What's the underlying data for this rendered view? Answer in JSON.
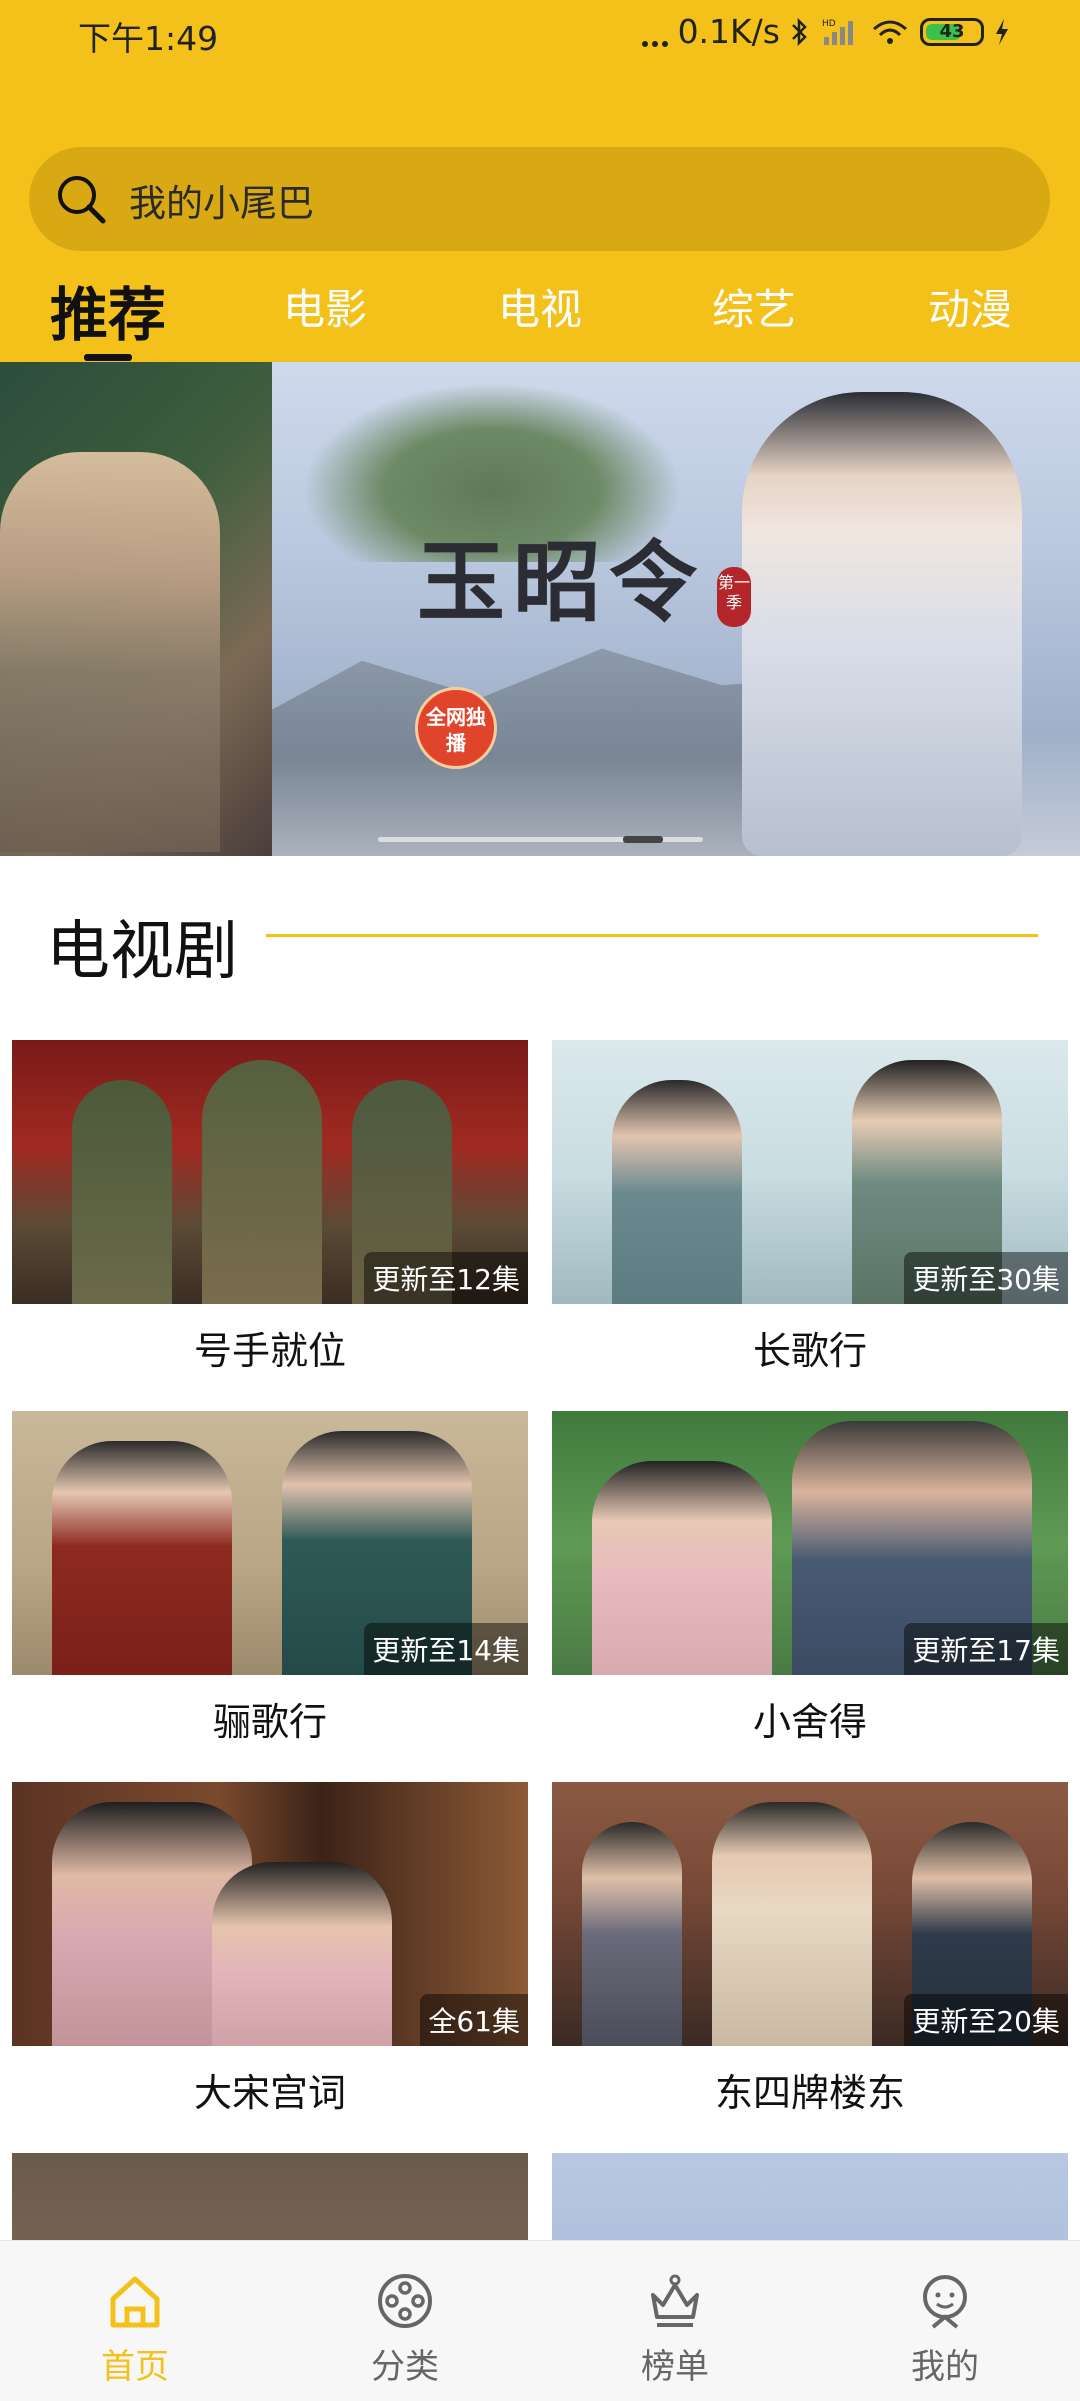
{
  "status_bar": {
    "time": "下午1:49",
    "network_speed": "0.1K/s",
    "battery": "43"
  },
  "search": {
    "placeholder_text": "我的小尾巴"
  },
  "tabs": [
    {
      "label": "推荐",
      "active": true
    },
    {
      "label": "电影"
    },
    {
      "label": "电视"
    },
    {
      "label": "综艺"
    },
    {
      "label": "动漫"
    }
  ],
  "banner": {
    "title": "玉昭令",
    "season_tag": "第一季",
    "badge": "全网独播"
  },
  "section": {
    "title": "电视剧"
  },
  "shows": [
    {
      "title": "号手就位",
      "episodes": "更新至12集"
    },
    {
      "title": "长歌行",
      "episodes": "更新至30集"
    },
    {
      "title": "骊歌行",
      "episodes": "更新至14集"
    },
    {
      "title": "小舍得",
      "episodes": "更新至17集"
    },
    {
      "title": "大宋宫词",
      "episodes": "全61集"
    },
    {
      "title": "东四牌楼东",
      "episodes": "更新至20集"
    }
  ],
  "bottom_nav": [
    {
      "label": "首页",
      "icon": "home-icon",
      "active": true
    },
    {
      "label": "分类",
      "icon": "film-reel-icon"
    },
    {
      "label": "榜单",
      "icon": "crown-icon"
    },
    {
      "label": "我的",
      "icon": "profile-icon"
    }
  ],
  "colors": {
    "accent": "#F4C11B",
    "search_bg": "#D8A913"
  }
}
